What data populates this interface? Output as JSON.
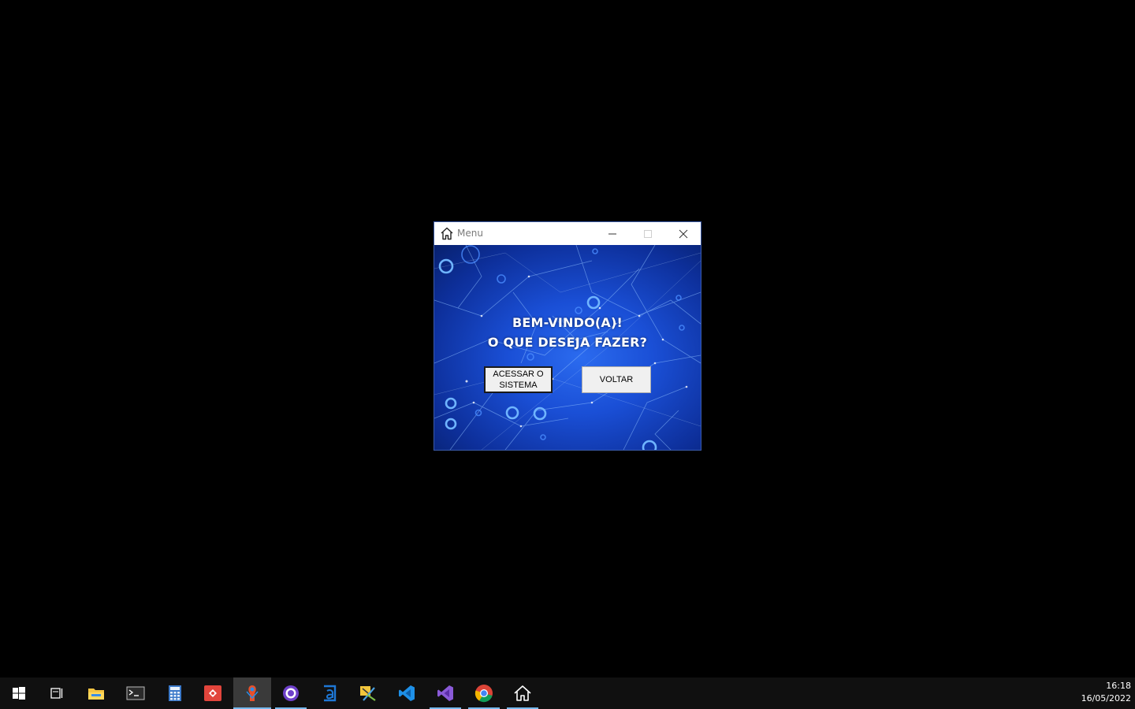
{
  "window": {
    "title": "Menu",
    "icon": "home-icon",
    "controls": {
      "minimize": "minimize-icon",
      "maximize": "maximize-icon",
      "close": "close-icon"
    }
  },
  "content": {
    "heading_line1": "BEM-VINDO(A)!",
    "heading_line2": "O QUE DESEJA FAZER?",
    "access_button": "ACESSAR O SISTEMA",
    "back_button": "VOLTAR"
  },
  "taskbar": {
    "items": [
      {
        "icon": "windows-start-icon"
      },
      {
        "icon": "task-view-icon"
      },
      {
        "icon": "file-explorer-icon"
      },
      {
        "icon": "terminal-icon"
      },
      {
        "icon": "calculator-icon"
      },
      {
        "icon": "git-gui-icon"
      },
      {
        "icon": "app-active-icon"
      },
      {
        "icon": "github-desktop-icon"
      },
      {
        "icon": "azure-data-studio-icon"
      },
      {
        "icon": "xampp-icon"
      },
      {
        "icon": "vscode-icon"
      },
      {
        "icon": "visual-studio-icon"
      },
      {
        "icon": "chrome-icon"
      },
      {
        "icon": "home-app-icon"
      }
    ],
    "time": "16:18",
    "date": "16/05/2022"
  },
  "colors": {
    "taskbar": "#101010",
    "accent_underline": "#76b9ed",
    "client_blue": "#1a4fd6"
  }
}
